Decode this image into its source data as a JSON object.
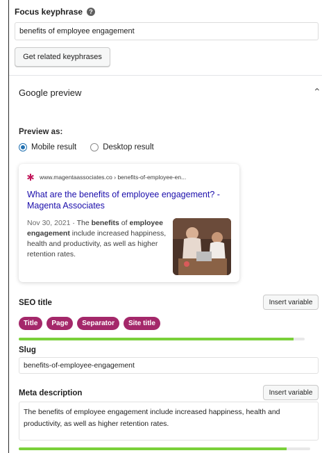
{
  "focus_keyphrase": {
    "label": "Focus keyphrase",
    "help_icon": "question-circle-icon",
    "value": "benefits of employee engagement",
    "related_button": "Get related keyphrases"
  },
  "google_preview": {
    "title": "Google preview",
    "collapse_icon": "chevron-up-icon",
    "preview_as_label": "Preview as:",
    "options": [
      {
        "label": "Mobile result",
        "selected": true
      },
      {
        "label": "Desktop result",
        "selected": false
      }
    ],
    "card": {
      "url": "www.magentaassociates.co › benefits-of-employee-en...",
      "title": "What are the benefits of employee engagement? - Magenta Associates",
      "date": "Nov 30, 2021",
      "snippet_pre": " · The ",
      "snippet_bold1": "benefits",
      "snippet_mid": " of ",
      "snippet_bold2": "employee engagement",
      "snippet_post": " include increased happiness, health and productivity, as well as higher retention rates.",
      "favicon_color": "#c2185b",
      "title_color": "#1a0dab"
    }
  },
  "seo_title": {
    "label": "SEO title",
    "insert_button": "Insert variable",
    "tokens": [
      "Title",
      "Page",
      "Separator",
      "Site title"
    ],
    "token_color": "#a4286a",
    "progress": 0.96,
    "progress_color": "#7ad03a"
  },
  "slug": {
    "label": "Slug",
    "value": "benefits-of-employee-engagement"
  },
  "meta_description": {
    "label": "Meta description",
    "insert_button": "Insert variable",
    "value": "The benefits of employee engagement include increased happiness, health and productivity, as well as higher retention rates.",
    "progress": 0.92
  }
}
